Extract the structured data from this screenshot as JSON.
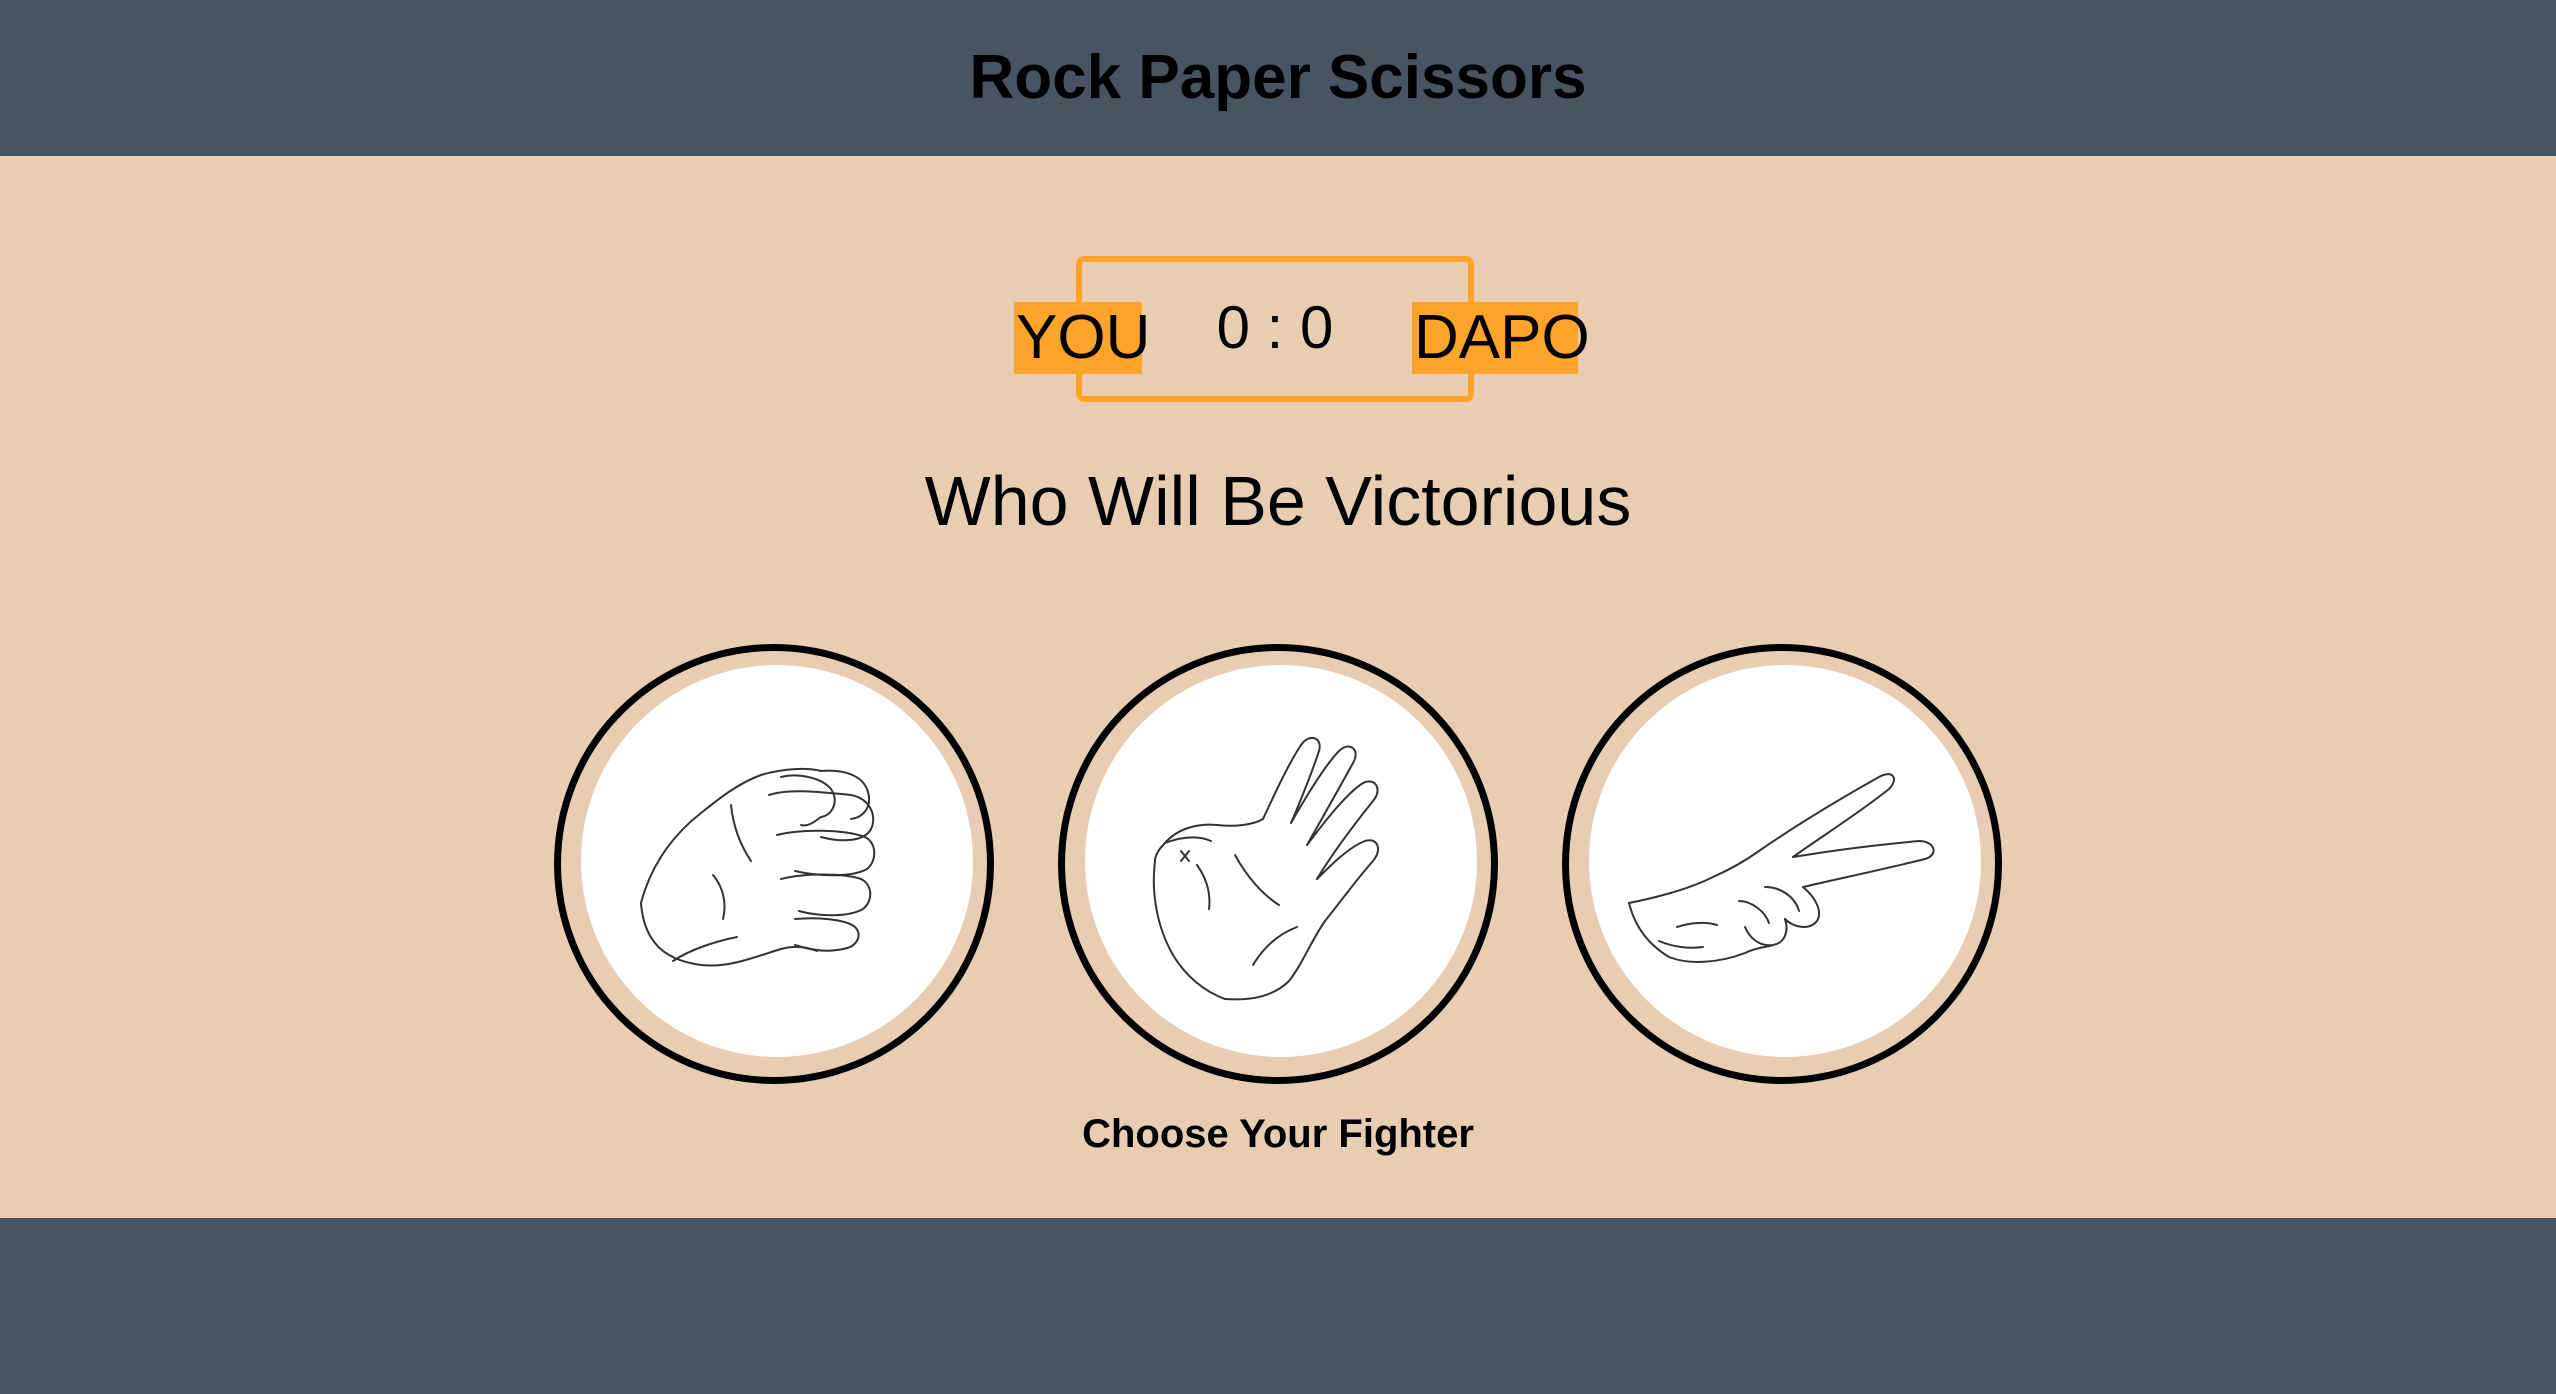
{
  "header": {
    "title": "Rock Paper Scissors"
  },
  "scoreboard": {
    "user_label": "YOU",
    "computer_label": "DAPO",
    "user_score": 0,
    "computer_score": 0,
    "score_text": "0 : 0"
  },
  "result": {
    "message": "Who Will Be Victorious"
  },
  "choices": [
    {
      "id": "rock",
      "icon": "rock-hand-icon"
    },
    {
      "id": "paper",
      "icon": "paper-hand-icon"
    },
    {
      "id": "scissors",
      "icon": "scissors-hand-icon"
    }
  ],
  "action": {
    "message": "Choose Your Fighter"
  },
  "colors": {
    "header_bg": "#485461",
    "body_bg": "#e9cdb2",
    "accent": "#fea42a"
  }
}
